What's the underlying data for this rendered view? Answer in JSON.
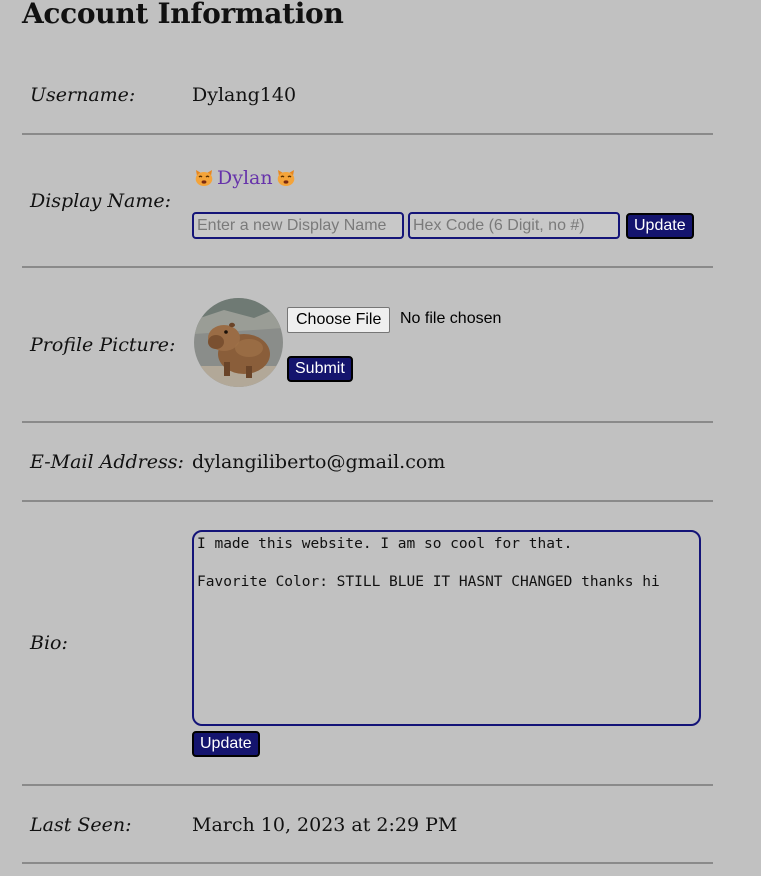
{
  "page": {
    "heading": "Account Information"
  },
  "username": {
    "label": "Username:",
    "value": "Dylang140"
  },
  "display_name": {
    "label": "Display Name:",
    "name": "Dylan",
    "name_color": "#6633aa",
    "emoji_icon": "cat-face-icon",
    "name_input_placeholder": "Enter a new Display Name",
    "hex_input_placeholder": "Hex Code (6 Digit, no #)",
    "update_label": "Update"
  },
  "profile_picture": {
    "label": "Profile Picture:",
    "choose_file_label": "Choose File",
    "file_status": "No file chosen",
    "submit_label": "Submit"
  },
  "email": {
    "label": "E-Mail Address:",
    "value": "dylangiliberto@gmail.com"
  },
  "bio": {
    "label": "Bio:",
    "text": "I made this website. I am so cool for that.\n\nFavorite Color: STILL BLUE IT HASNT CHANGED thanks hi",
    "update_label": "Update"
  },
  "last_seen": {
    "label": "Last Seen:",
    "value": "March 10, 2023 at 2:29 PM"
  },
  "colors": {
    "background": "#c1c1c1",
    "button_bg": "#14146e",
    "input_border": "#141478",
    "divider": "#8a8a8a"
  }
}
